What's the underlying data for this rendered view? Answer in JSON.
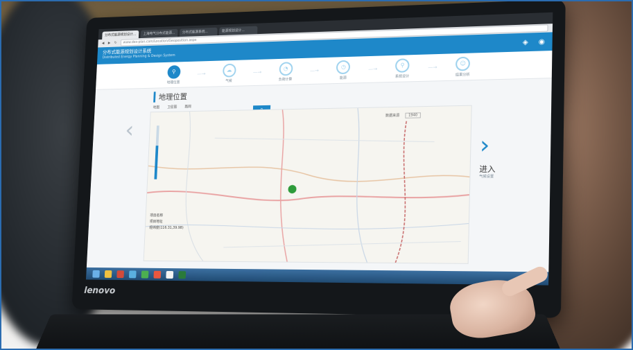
{
  "browser": {
    "tabs": [
      "分布式能源规划设计...",
      "上海电气分布式能源...",
      "分布式能源系统...",
      "能源规划设计..."
    ],
    "address": "www.des-plan.com/Location/Geoposition.aspx"
  },
  "app": {
    "title": "分布式能源规划设计系统",
    "subtitle": "Distributed Energy Planning & Design System"
  },
  "steps": [
    {
      "label": "地理位置"
    },
    {
      "label": "气候"
    },
    {
      "label": "负荷计算"
    },
    {
      "label": "能源"
    },
    {
      "label": "系统设计"
    },
    {
      "label": "结果分析"
    }
  ],
  "section_title": "地理位置",
  "map": {
    "options": [
      "地图",
      "卫星图",
      "路网"
    ],
    "legend_label": "数据来源",
    "legend_value": "1940"
  },
  "project": {
    "name_label": "项目名称",
    "location_label": "项目地址",
    "coords": "经纬度(116.31,39.98)"
  },
  "nav": {
    "enter_label": "进入",
    "enter_sub": "气候设置"
  },
  "laptop": {
    "brand": "lenovo"
  },
  "colors": {
    "accent": "#1e88c9",
    "header": "#1e88c9",
    "frame": "#2b6cb0"
  }
}
